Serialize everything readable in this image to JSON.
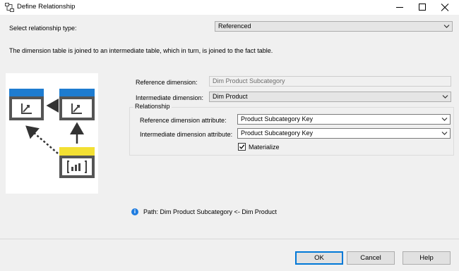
{
  "window": {
    "title": "Define Relationship",
    "icon": "relationship-icon"
  },
  "form": {
    "relationship_type_label": "Select relationship type:",
    "relationship_type_value": "Referenced",
    "description": "The dimension table is joined to an intermediate table, which in turn, is joined to the fact table.",
    "reference_dimension_label": "Reference dimension:",
    "reference_dimension_value": "Dim Product Subcategory",
    "intermediate_dimension_label": "Intermediate dimension:",
    "intermediate_dimension_value": "Dim Product",
    "relationship_group_caption": "Relationship",
    "reference_attr_label": "Reference dimension attribute:",
    "reference_attr_value": "Product Subcategory Key",
    "intermediate_attr_label": "Intermediate dimension attribute:",
    "intermediate_attr_value": "Product Subcategory Key",
    "materialize_label": "Materialize",
    "materialize_checked": true
  },
  "path_info": {
    "text": "Path: Dim Product Subcategory <- Dim Product"
  },
  "buttons": {
    "ok": "OK",
    "cancel": "Cancel",
    "help": "Help"
  },
  "colors": {
    "dimension_header": "#1e7cd0",
    "fact_header": "#f3e033",
    "box_border": "#555555",
    "accent": "#0078d7"
  }
}
